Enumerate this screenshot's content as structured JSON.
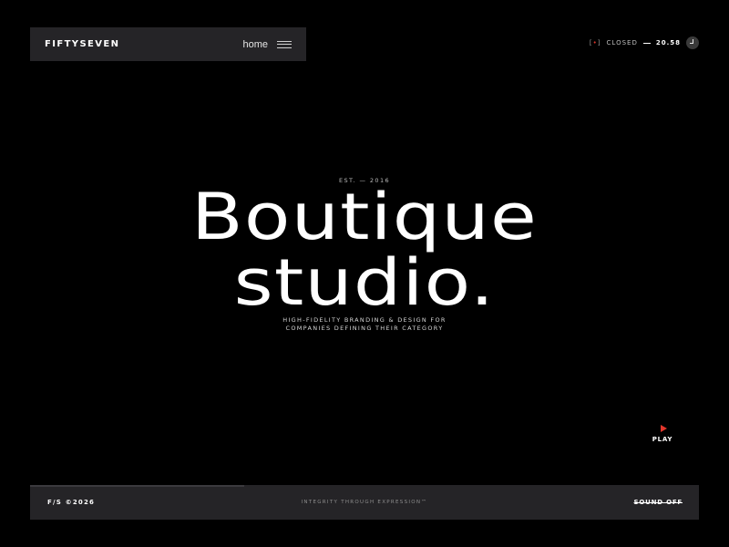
{
  "nav": {
    "logo": "FIFTYSEVEN",
    "link_label": "home",
    "menu_icon": "hamburger-menu-icon"
  },
  "status": {
    "bracket_open": "[",
    "indicator": "•",
    "bracket_close": "]",
    "state": "CLOSED",
    "time": "20.58",
    "clock_icon": "clock-icon"
  },
  "hero": {
    "est": "EST. — 2016",
    "headline_line1": "Boutique",
    "headline_line2": "studio.",
    "tagline_line1": "HIGH-FIDELITY BRANDING & DESIGN FOR",
    "tagline_line2": "COMPANIES DEFINING THEIR CATEGORY"
  },
  "play": {
    "label": "PLAY",
    "icon": "play-icon"
  },
  "footer": {
    "left": "F/S ©2026",
    "center": "INTEGRITY THROUGH EXPRESSION™",
    "right": "SOUND OFF"
  },
  "colors": {
    "background": "#000000",
    "panel": "#252427",
    "accent": "#e2362b",
    "text": "#ffffff"
  }
}
